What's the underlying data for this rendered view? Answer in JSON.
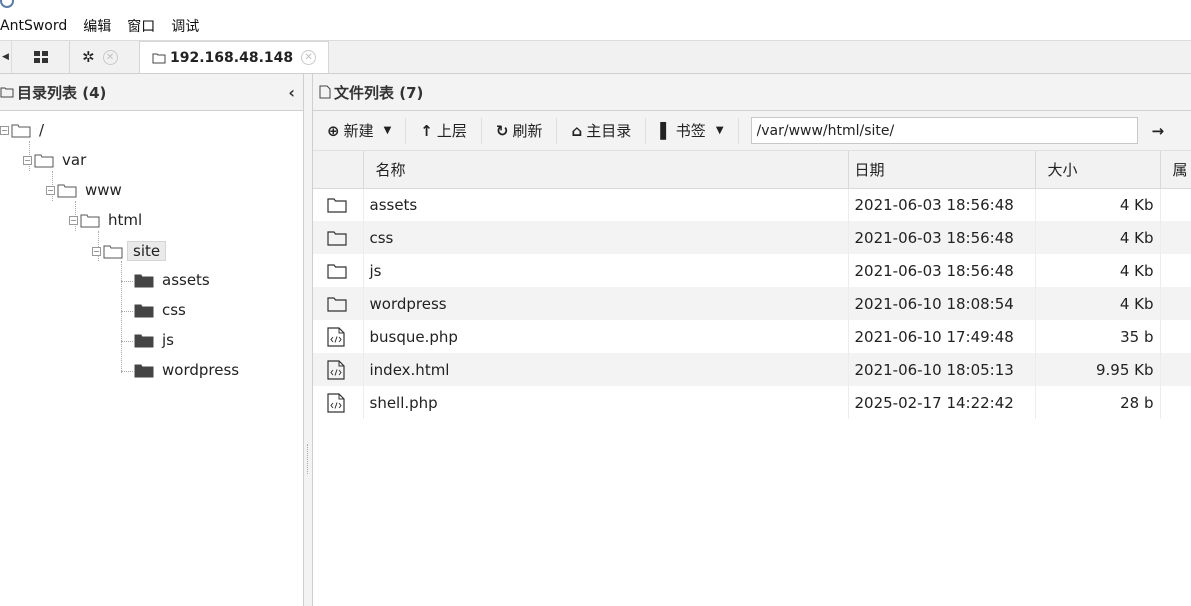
{
  "window": {
    "title": "AntSword"
  },
  "menubar": {
    "items": [
      "AntSword",
      "编辑",
      "窗口",
      "调试"
    ]
  },
  "tabs": {
    "items": [
      {
        "label": "192.168.48.148"
      }
    ]
  },
  "left_panel": {
    "title": "目录列表 (4)",
    "tree": {
      "root": "/",
      "var": "var",
      "www": "www",
      "html": "html",
      "site": "site",
      "children": [
        "assets",
        "css",
        "js",
        "wordpress"
      ]
    }
  },
  "right_panel": {
    "title": "文件列表 (7)",
    "toolbar": {
      "new": "新建",
      "up": "上层",
      "refresh": "刷新",
      "home": "主目录",
      "bookmark": "书签",
      "path": "/var/www/html/site/"
    },
    "columns": {
      "name": "名称",
      "date": "日期",
      "size": "大小",
      "attr": "属"
    },
    "files": [
      {
        "icon": "folder-icon",
        "name": "assets",
        "date": "2021-06-03 18:56:48",
        "size": "4 Kb"
      },
      {
        "icon": "folder-icon",
        "name": "css",
        "date": "2021-06-03 18:56:48",
        "size": "4 Kb"
      },
      {
        "icon": "folder-icon",
        "name": "js",
        "date": "2021-06-03 18:56:48",
        "size": "4 Kb"
      },
      {
        "icon": "folder-icon",
        "name": "wordpress",
        "date": "2021-06-10 18:08:54",
        "size": "4 Kb"
      },
      {
        "icon": "code-file-icon",
        "name": "busque.php",
        "date": "2021-06-10 17:49:48",
        "size": "35 b"
      },
      {
        "icon": "code-file-icon",
        "name": "index.html",
        "date": "2021-06-10 18:05:13",
        "size": "9.95 Kb"
      },
      {
        "icon": "code-file-icon",
        "name": "shell.php",
        "date": "2025-02-17 14:22:42",
        "size": "28 b"
      }
    ]
  }
}
